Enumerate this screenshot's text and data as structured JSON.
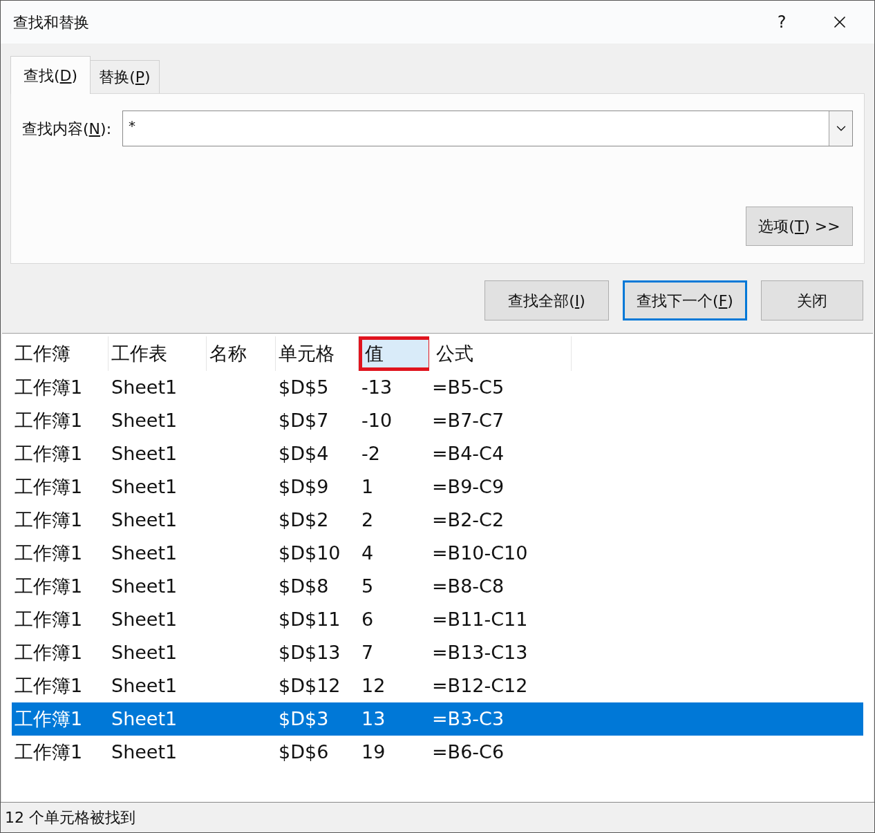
{
  "window": {
    "title": "查找和替换",
    "help": "?"
  },
  "tabs": [
    {
      "label_parts": [
        "查找(",
        "D",
        ")"
      ],
      "selected": true
    },
    {
      "label_parts": [
        "替换(",
        "P",
        ")"
      ],
      "selected": false
    }
  ],
  "find_field": {
    "label_parts": [
      "查找内容(",
      "N",
      "):"
    ],
    "value": "*"
  },
  "options_button": {
    "label_parts": [
      "选项(",
      "T",
      ") >>"
    ]
  },
  "buttons": [
    {
      "label_parts": [
        "查找全部(",
        "I",
        ")"
      ],
      "default": false
    },
    {
      "label_parts": [
        "查找下一个(",
        "F",
        ")"
      ],
      "default": true
    },
    {
      "label_parts": [
        "关闭"
      ],
      "default": false
    }
  ],
  "results": {
    "columns": [
      {
        "label": "工作簿",
        "highlighted": false,
        "annotated": false
      },
      {
        "label": "工作表",
        "highlighted": false,
        "annotated": false
      },
      {
        "label": "名称",
        "highlighted": false,
        "annotated": false
      },
      {
        "label": "单元格",
        "highlighted": false,
        "annotated": false
      },
      {
        "label": "值",
        "highlighted": true,
        "annotated": true
      },
      {
        "label": "公式",
        "highlighted": false,
        "annotated": false
      }
    ],
    "rows": [
      {
        "cells": [
          "工作簿1",
          "Sheet1",
          "",
          "$D$5",
          "-13",
          "=B5-C5"
        ],
        "selected": false
      },
      {
        "cells": [
          "工作簿1",
          "Sheet1",
          "",
          "$D$7",
          "-10",
          "=B7-C7"
        ],
        "selected": false
      },
      {
        "cells": [
          "工作簿1",
          "Sheet1",
          "",
          "$D$4",
          "-2",
          "=B4-C4"
        ],
        "selected": false
      },
      {
        "cells": [
          "工作簿1",
          "Sheet1",
          "",
          "$D$9",
          "1",
          "=B9-C9"
        ],
        "selected": false
      },
      {
        "cells": [
          "工作簿1",
          "Sheet1",
          "",
          "$D$2",
          "2",
          "=B2-C2"
        ],
        "selected": false
      },
      {
        "cells": [
          "工作簿1",
          "Sheet1",
          "",
          "$D$10",
          "4",
          "=B10-C10"
        ],
        "selected": false
      },
      {
        "cells": [
          "工作簿1",
          "Sheet1",
          "",
          "$D$8",
          "5",
          "=B8-C8"
        ],
        "selected": false
      },
      {
        "cells": [
          "工作簿1",
          "Sheet1",
          "",
          "$D$11",
          "6",
          "=B11-C11"
        ],
        "selected": false
      },
      {
        "cells": [
          "工作簿1",
          "Sheet1",
          "",
          "$D$13",
          "7",
          "=B13-C13"
        ],
        "selected": false
      },
      {
        "cells": [
          "工作簿1",
          "Sheet1",
          "",
          "$D$12",
          "12",
          "=B12-C12"
        ],
        "selected": false
      },
      {
        "cells": [
          "工作簿1",
          "Sheet1",
          "",
          "$D$3",
          "13",
          "=B3-C3"
        ],
        "selected": true
      },
      {
        "cells": [
          "工作簿1",
          "Sheet1",
          "",
          "$D$6",
          "19",
          "=B6-C6"
        ],
        "selected": false
      }
    ]
  },
  "status_bar": {
    "text": "12 个单元格被找到"
  }
}
